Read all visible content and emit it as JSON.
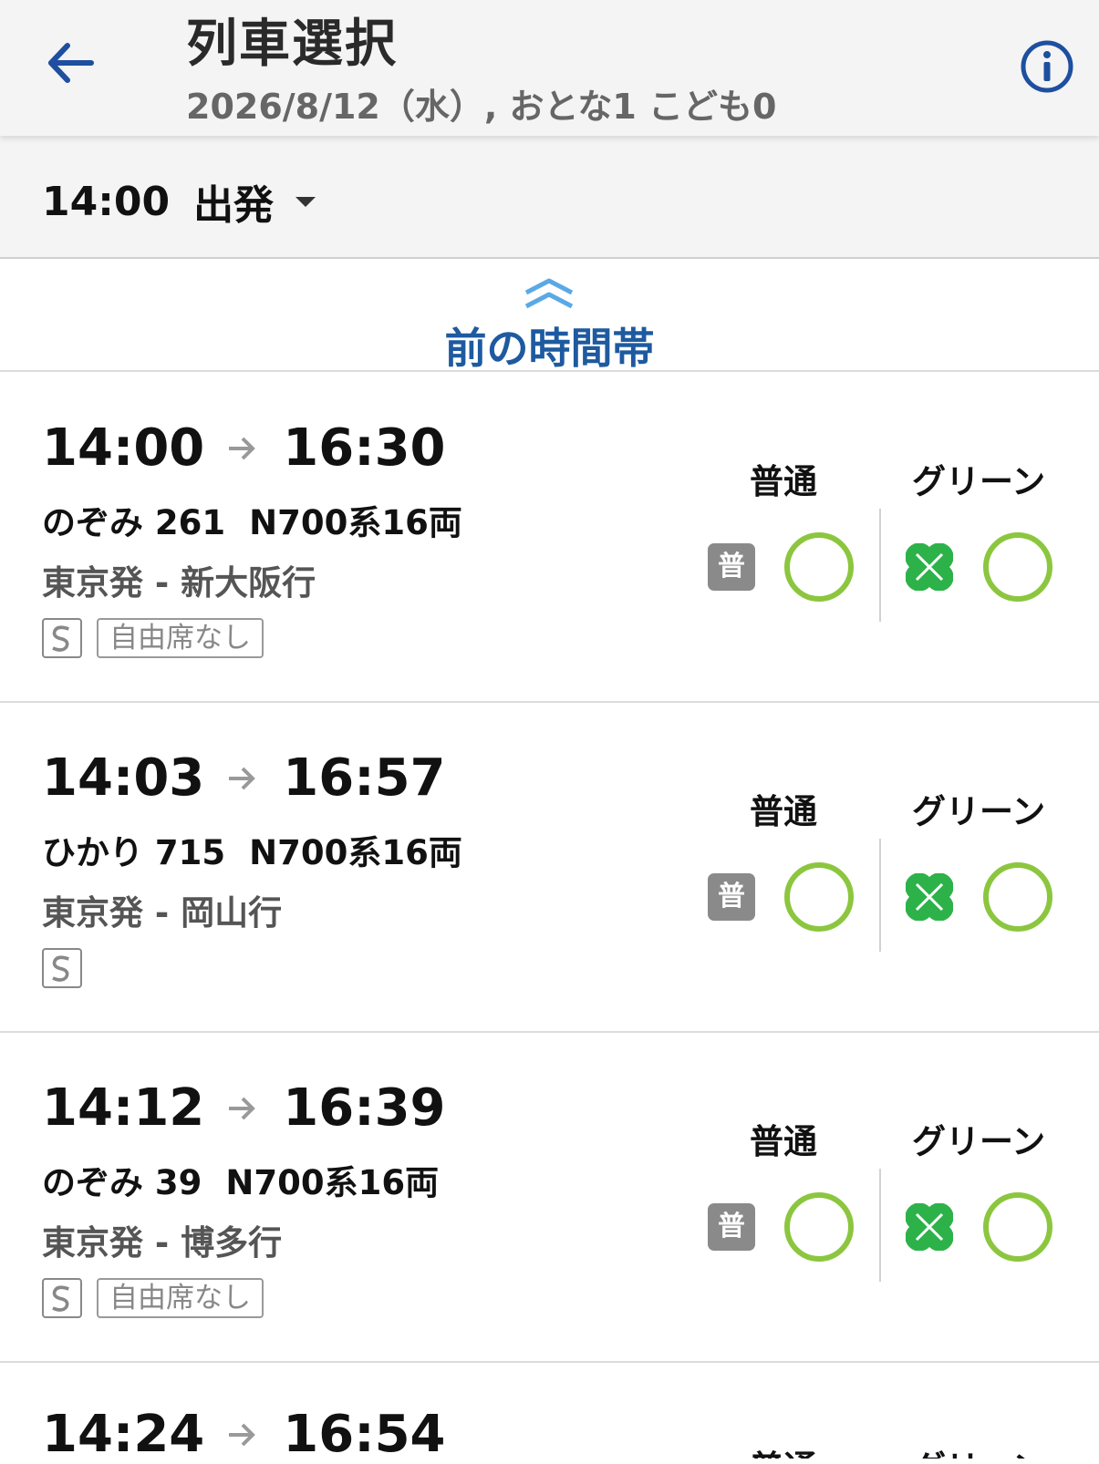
{
  "header": {
    "title": "列車選択",
    "subtitle": "2026/8/12（水）, おとな1 こども0",
    "back_icon": "arrow-left-icon",
    "info_icon": "info-icon",
    "accent_color": "#1e4fa0"
  },
  "time_filter": {
    "time": "14:00",
    "mode": "出発"
  },
  "prev_slot": {
    "label": "前の時間帯"
  },
  "seat_headers": {
    "standard": "普通",
    "green": "グリーン",
    "standard_badge": "普"
  },
  "colors": {
    "available_ring": "#8cc63f",
    "green_car": "#2db24a",
    "standard_badge": "#8a8a8a"
  },
  "trains": [
    {
      "dep": "14:00",
      "arr": "16:30",
      "name": "のぞみ 261",
      "car": "N700系16両",
      "route": "東京発 - 新大阪行",
      "tag": "自由席なし",
      "standard_status": "available",
      "green_status": "available"
    },
    {
      "dep": "14:03",
      "arr": "16:57",
      "name": "ひかり 715",
      "car": "N700系16両",
      "route": "東京発 - 岡山行",
      "tag": "",
      "standard_status": "available",
      "green_status": "available"
    },
    {
      "dep": "14:12",
      "arr": "16:39",
      "name": "のぞみ 39",
      "car": "N700系16両",
      "route": "東京発 - 博多行",
      "tag": "自由席なし",
      "standard_status": "available",
      "green_status": "available"
    },
    {
      "dep": "14:24",
      "arr": "16:54",
      "name": "",
      "car": "",
      "route": "",
      "tag": "",
      "standard_status": "",
      "green_status": ""
    }
  ]
}
